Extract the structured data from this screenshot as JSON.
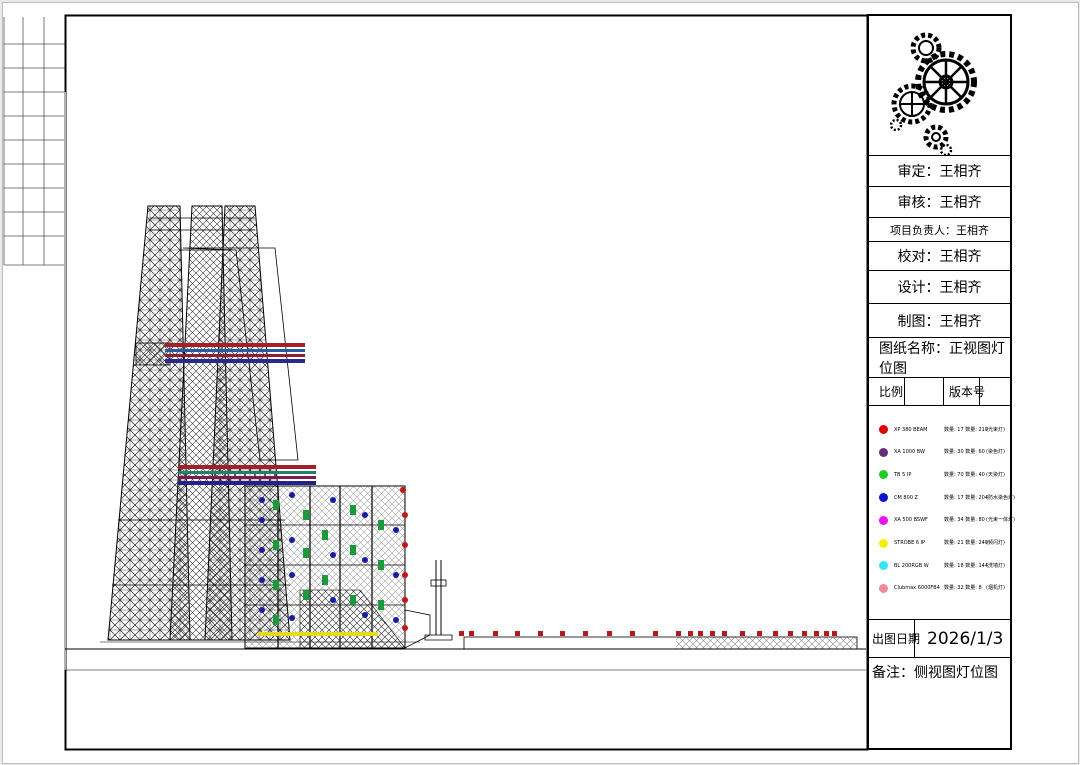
{
  "title_block": {
    "approve": "审定：王相齐",
    "review": "审核：王相齐",
    "project_lead": "项目负责人：王相齐",
    "proofread": "校对：王相齐",
    "design": "设计：王相齐",
    "drafting": "制图：王相齐",
    "drawing_name": "图纸名称：正视图灯位图",
    "scale_label": "比例",
    "version_label": "版本号",
    "date_label": "出图日期",
    "date_value": "2026/1/3",
    "remark": "备注：侧视图灯位图"
  },
  "legend": [
    {
      "name": "XP 380 BEAM",
      "qty": "数量: 17  数量: 210",
      "note": "(光束灯)",
      "color": "#e00000"
    },
    {
      "name": "XA 1000 BW",
      "qty": "数量: 30  数量: 60",
      "note": "(染色灯)",
      "color": "#6a2c7a"
    },
    {
      "name": "TB 5 IP",
      "qty": "数量: 70  数量: 40",
      "note": "(天染灯)",
      "color": "#22cc22"
    },
    {
      "name": "CM 800 Z",
      "qty": "数量: 17  数量: 204",
      "note": "(防水染色灯)",
      "color": "#1010d0"
    },
    {
      "name": "XA 500 BSWF",
      "qty": "数量: 34  数量: 80",
      "note": "(光束一体灯)",
      "color": "#ee10ee"
    },
    {
      "name": "STROBE 6 IP",
      "qty": "数量: 21  数量: 240",
      "note": "(频闪灯)",
      "color": "#f2f200"
    },
    {
      "name": "BL 200RGB W",
      "qty": "数量: 18  数量: 144",
      "note": "(洗墙灯)",
      "color": "#33e6f0"
    },
    {
      "name": "Clubmax 6000FB4",
      "qty": "数量: 32  数量: 8",
      "note": "(烟机灯)",
      "color": "#f08a96"
    }
  ]
}
